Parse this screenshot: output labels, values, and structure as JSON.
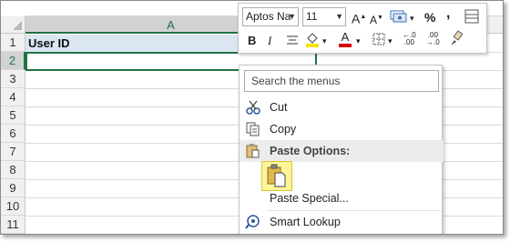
{
  "sheet": {
    "column_label": "A",
    "rows": [
      "1",
      "2",
      "3",
      "4",
      "5",
      "6",
      "7",
      "8",
      "9",
      "10",
      "11"
    ],
    "selected_row": "2",
    "cell_a1": "User ID"
  },
  "mini_toolbar": {
    "font_name": "Aptos Na",
    "font_size": "11",
    "buttons": {
      "grow_font": "A",
      "shrink_font": "A",
      "percent": "%",
      "comma": ",",
      "bold": "B",
      "italic": "I",
      "font_color": "A"
    },
    "colors": {
      "highlight": "#f5e600",
      "font_color": "#d40000",
      "accent": "#217346"
    }
  },
  "context_menu": {
    "search_placeholder": "Search the menus",
    "items": {
      "cut": "Cut",
      "copy": "Copy",
      "paste_options": "Paste Options:",
      "paste_special": "Paste Special...",
      "smart_lookup": "Smart Lookup"
    },
    "icons": [
      "scissors-icon",
      "copy-icon",
      "clipboard-icon",
      "paste-icon",
      "smart-lookup-icon"
    ]
  }
}
